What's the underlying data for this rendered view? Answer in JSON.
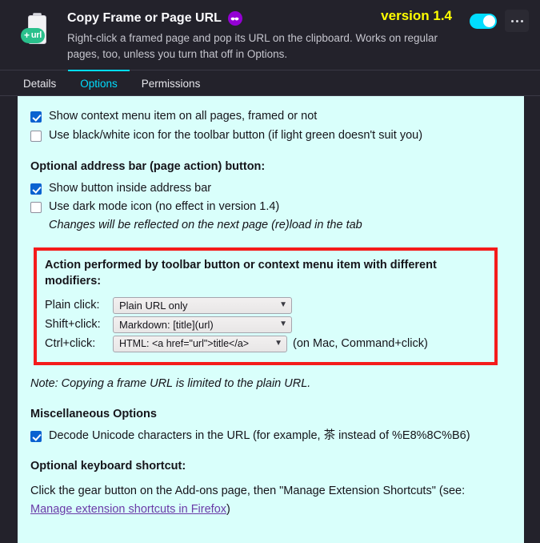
{
  "header": {
    "icon_name": "clipboard-url-icon",
    "icon_badge_text": "url",
    "title": "Copy Frame or Page URL",
    "private_badge_name": "private-browsing-badge",
    "description": "Right-click a framed page and pop its URL on the clipboard. Works on regular pages, too, unless you turn that off in Options.",
    "version_label": "version 1.4",
    "toggle_state": "on",
    "more_menu_label": "•••"
  },
  "tabs": [
    {
      "label": "Details",
      "active": false
    },
    {
      "label": "Options",
      "active": true
    },
    {
      "label": "Permissions",
      "active": false
    }
  ],
  "options": {
    "general_checkboxes": [
      {
        "label": "Show context menu item on all pages, framed or not",
        "checked": true
      },
      {
        "label": "Use black/white icon for the toolbar button (if light green doesn't suit you)",
        "checked": false
      }
    ],
    "address_bar_heading": "Optional address bar (page action) button:",
    "address_bar_checkboxes": [
      {
        "label": "Show button inside address bar",
        "checked": true
      },
      {
        "label": "Use dark mode icon (no effect in version 1.4)",
        "checked": false
      }
    ],
    "address_bar_hint": "Changes will be reflected on the next page (re)load in the tab",
    "modifier_box": {
      "title": "Action performed by toolbar button or context menu item with different modifiers:",
      "border_color": "#f41b1b",
      "rows": [
        {
          "label": "Plain click:",
          "value": "Plain URL only",
          "suffix": ""
        },
        {
          "label": "Shift+click:",
          "value": "Markdown: [title](url)",
          "suffix": ""
        },
        {
          "label": "Ctrl+click:",
          "value": "HTML: <a href=\"url\">title</a>",
          "suffix": "(on Mac, Command+click)"
        }
      ]
    },
    "note": "Note: Copying a frame URL is limited to the plain URL.",
    "misc_heading": "Miscellaneous Options",
    "misc_checkboxes": [
      {
        "label": "Decode Unicode characters in the URL (for example, 茶 instead of %E8%8C%B6)",
        "checked": true
      }
    ],
    "shortcut_heading": "Optional keyboard shortcut:",
    "shortcut_text": "Click the gear button on the Add-ons page, then \"Manage Extension Shortcuts\" (see:",
    "shortcut_link": "Manage extension shortcuts in Firefox",
    "shortcut_text_end": ")"
  },
  "colors": {
    "panel_bg": "#d9fffb",
    "app_bg": "#23222b",
    "accent": "#00ddff",
    "version_color": "#ffff00",
    "highlight_red": "#f41b1b",
    "link_purple": "#6a3ba8",
    "checkbox_blue": "#0a62d0"
  }
}
